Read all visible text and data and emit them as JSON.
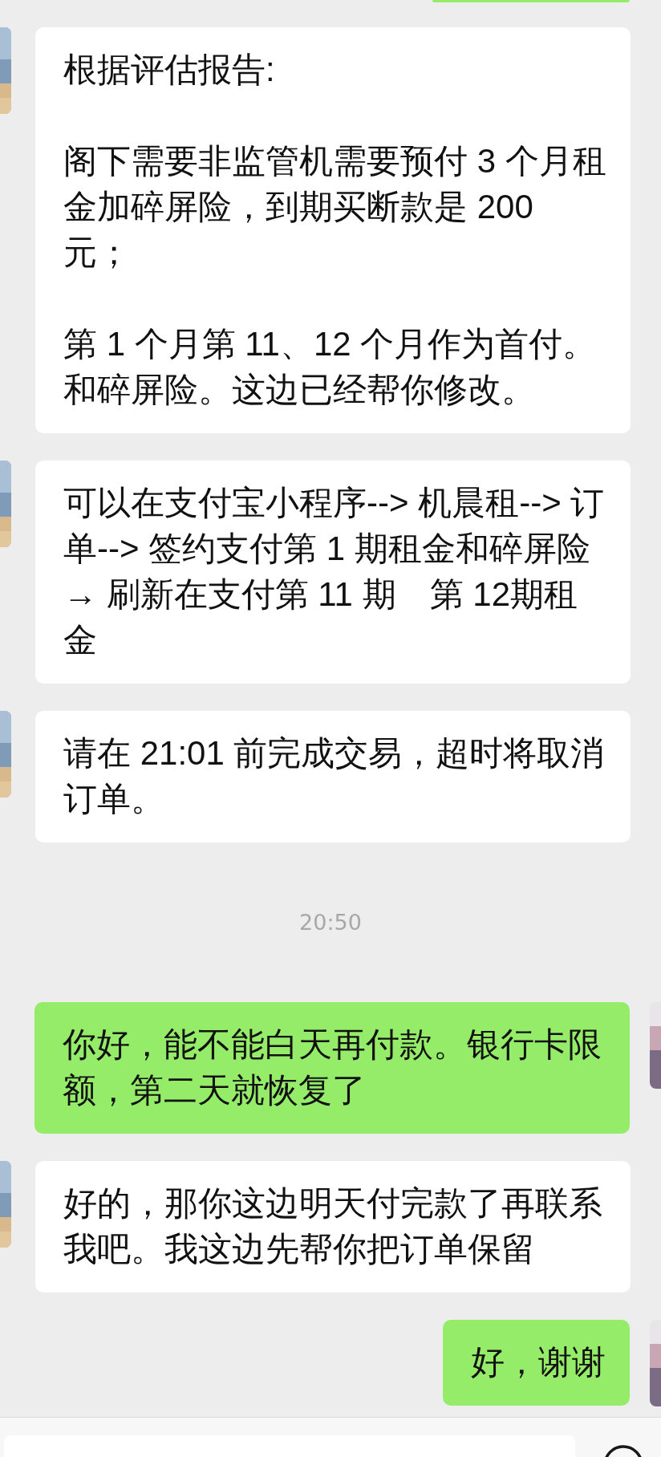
{
  "messages": [
    {
      "kind": "incoming",
      "paragraphs": [
        "根据评估报告:",
        "阁下需要非监管机需要预付 3 个月租金加碎屏险，到期买断款是 200 元；",
        "第 1 个月第 11、12 个月作为首付。和碎屏险。这边已经帮你修改。"
      ]
    },
    {
      "kind": "incoming",
      "paragraphs": [
        "可以在支付宝小程序--> 机晨租--> 订单--> 签约支付第 1 期租金和碎屏险 → 刷新在支付第 11 期　第 12期租金"
      ]
    },
    {
      "kind": "incoming",
      "paragraphs": [
        "请在 21:01 前完成交易，超时将取消订单。"
      ]
    },
    {
      "kind": "time",
      "text": "20:50"
    },
    {
      "kind": "outgoing",
      "paragraphs": [
        "你好，能不能白天再付款。银行卡限额，第二天就恢复了"
      ]
    },
    {
      "kind": "incoming",
      "paragraphs": [
        "好的，那你这边明天付完款了再联系我吧。我这边先帮你把订单保留"
      ]
    },
    {
      "kind": "outgoing",
      "paragraphs": [
        "好，谢谢"
      ]
    }
  ]
}
